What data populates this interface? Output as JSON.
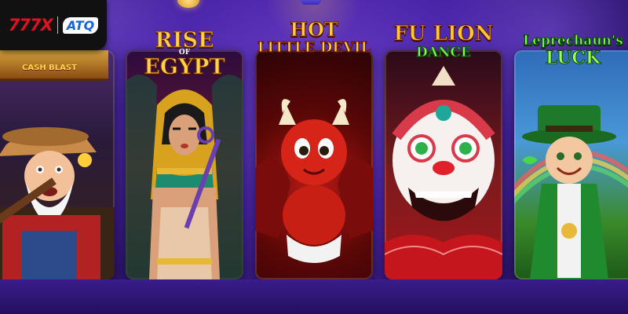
{
  "logo": {
    "brand_a": "777X",
    "brand_b": "ATQ"
  },
  "games": [
    {
      "title": "",
      "subtitle": "CASH BLAST",
      "icon": "gold-miner-icon"
    },
    {
      "title": "RISE",
      "subtitle_small": "OF",
      "subtitle": "EGYPT",
      "icon": "pharaoh-queen-icon"
    },
    {
      "title": "HOT",
      "subtitle": "LITTLE DEVIL",
      "icon": "devil-icon"
    },
    {
      "title": "FU LION",
      "subtitle": "DANCE",
      "icon": "lion-dance-icon"
    },
    {
      "title": "Leprechaun's",
      "subtitle": "LUCK",
      "icon": "leprechaun-icon"
    }
  ],
  "colors": {
    "background": "#4a25a8",
    "gold": "#ffd24a",
    "green": "#7dff4a",
    "logo_red": "#e0121f",
    "logo_blue": "#1565d8"
  }
}
